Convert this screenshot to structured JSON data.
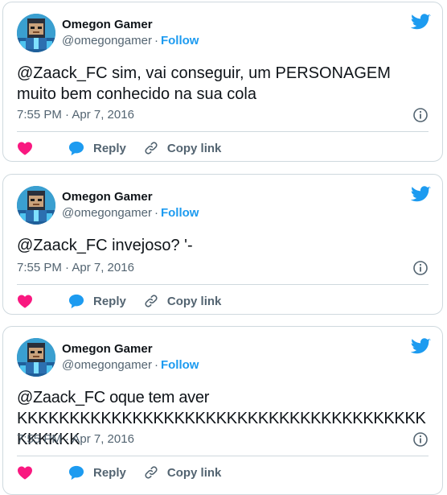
{
  "colors": {
    "accent": "#1d9bf0",
    "like": "#f91880",
    "muted": "#536471",
    "border": "#cfd9de"
  },
  "icons": {
    "brand": "twitter-bird-icon",
    "like": "heart-icon",
    "reply": "speech-bubble-icon",
    "copy": "link-icon",
    "info": "info-icon"
  },
  "tweets": [
    {
      "author": {
        "name": "Omegon Gamer",
        "handle": "@omegongamer"
      },
      "follow_label": "Follow",
      "separator": "·",
      "text": "@Zaack_FC sim, vai conseguir, um PERSONAGEM muito bem conhecido na sua cola",
      "timestamp": "7:55 PM · Apr 7, 2016",
      "reply_label": "Reply",
      "copy_label": "Copy link"
    },
    {
      "author": {
        "name": "Omegon Gamer",
        "handle": "@omegongamer"
      },
      "follow_label": "Follow",
      "separator": "·",
      "text": "@Zaack_FC invejoso? '-",
      "timestamp": "7:55 PM · Apr 7, 2016",
      "reply_label": "Reply",
      "copy_label": "Copy link"
    },
    {
      "author": {
        "name": "Omegon Gamer",
        "handle": "@omegongamer"
      },
      "follow_label": "Follow",
      "separator": "·",
      "text": "@Zaack_FC oque tem aver KKKKKKKKKKKKKKKKKKKKKKKKKKKKKKKKKKKKKKKKKKKKK",
      "timestamp": "7:55 PM · Apr 7, 2016",
      "reply_label": "Reply",
      "copy_label": "Copy link"
    }
  ]
}
